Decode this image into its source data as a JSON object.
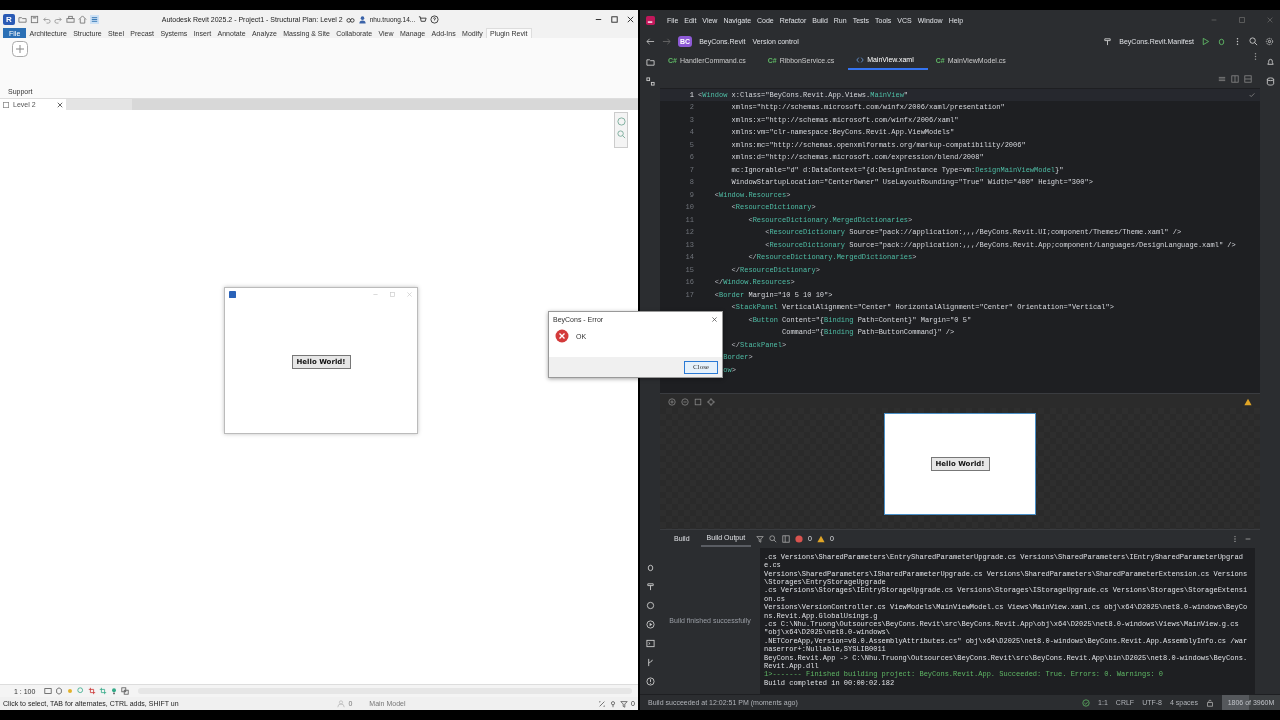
{
  "revit": {
    "app_logo": "R",
    "title": "Autodesk Revit 2025.2 - Project1 - Structural Plan: Level 2",
    "user": "nhu.truong.14...",
    "ribbon_tabs": [
      {
        "label": "File",
        "kind": "app",
        "selected": false
      },
      {
        "label": "Architecture",
        "kind": "tab",
        "selected": false
      },
      {
        "label": "Structure",
        "kind": "tab",
        "selected": false
      },
      {
        "label": "Steel",
        "kind": "tab",
        "selected": false
      },
      {
        "label": "Precast",
        "kind": "tab",
        "selected": false
      },
      {
        "label": "Systems",
        "kind": "tab",
        "selected": false
      },
      {
        "label": "Insert",
        "kind": "tab",
        "selected": false
      },
      {
        "label": "Annotate",
        "kind": "tab",
        "selected": false
      },
      {
        "label": "Analyze",
        "kind": "tab",
        "selected": false
      },
      {
        "label": "Massing & Site",
        "kind": "tab",
        "selected": false
      },
      {
        "label": "Collaborate",
        "kind": "tab",
        "selected": false
      },
      {
        "label": "View",
        "kind": "tab",
        "selected": false
      },
      {
        "label": "Manage",
        "kind": "tab",
        "selected": false
      },
      {
        "label": "Add-Ins",
        "kind": "tab",
        "selected": false
      },
      {
        "label": "Modify",
        "kind": "tab",
        "selected": false
      },
      {
        "label": "Plugin Revit",
        "kind": "tab",
        "selected": true
      }
    ],
    "panel_label": "Support",
    "view_tabs": [
      {
        "label": "Level 2",
        "selected": true
      }
    ],
    "plugin_window": {
      "button": "Hello World!"
    },
    "scale": "1 : 100",
    "status": "Click to select, TAB for alternates, CTRL adds, SHIFT un",
    "workset_count": "0",
    "model": "Main Model",
    "filter_count": "0"
  },
  "error_dialog": {
    "title": "BeyCons - Error",
    "message": "OK",
    "button": "Close"
  },
  "rider": {
    "menu": [
      "File",
      "Edit",
      "View",
      "Navigate",
      "Code",
      "Refactor",
      "Build",
      "Run",
      "Tests",
      "Tools",
      "VCS",
      "Window",
      "Help"
    ],
    "project_badge": "BC",
    "project": "BeyCons.Revit",
    "vcs": "Version control",
    "run_config": "BeyCons.Revit.Manifest",
    "tabs": [
      {
        "label": "HandlerCommand.cs",
        "badge": "C#",
        "selected": false
      },
      {
        "label": "RibbonService.cs",
        "badge": "C#",
        "selected": false
      },
      {
        "label": "MainView.xaml",
        "selected": true
      },
      {
        "label": "MainViewModel.cs",
        "badge": "C#",
        "selected": false
      }
    ],
    "code": [
      {
        "number": "1",
        "current": true,
        "tokens": [
          {
            "text": "<",
            "kind": "punct"
          },
          {
            "text": "Window",
            "kind": "tag"
          },
          {
            "text": " x:Class=\"BeyCons.Revit.App.Views.",
            "kind": "plain"
          },
          {
            "text": "MainView",
            "kind": "tag"
          },
          {
            "text": "\"",
            "kind": "plain"
          }
        ]
      },
      {
        "number": "2",
        "current": false,
        "tokens": [
          {
            "text": "        xmlns=\"http://schemas.microsoft.com/winfx/2006/xaml/presentation\"",
            "kind": "plain"
          }
        ]
      },
      {
        "number": "3",
        "current": false,
        "tokens": [
          {
            "text": "        xmlns:x=\"http://schemas.microsoft.com/winfx/2006/xaml\"",
            "kind": "plain"
          }
        ]
      },
      {
        "number": "4",
        "current": false,
        "tokens": [
          {
            "text": "        xmlns:vm=\"clr-namespace:BeyCons.Revit.App.ViewModels\"",
            "kind": "plain"
          }
        ]
      },
      {
        "number": "5",
        "current": false,
        "tokens": [
          {
            "text": "        xmlns:mc=\"http://schemas.openxmlformats.org/markup-compatibility/2006\"",
            "kind": "plain"
          }
        ]
      },
      {
        "number": "6",
        "current": false,
        "tokens": [
          {
            "text": "        xmlns:d=\"http://schemas.microsoft.com/expression/blend/2008\"",
            "kind": "plain"
          }
        ]
      },
      {
        "number": "7",
        "current": false,
        "tokens": [
          {
            "text": "        mc:Ignorable=\"d\" d:DataContext=\"{d:DesignInstance Type=vm:",
            "kind": "plain"
          },
          {
            "text": "DesignMainViewModel",
            "kind": "tag"
          },
          {
            "text": "}\"",
            "kind": "plain"
          }
        ]
      },
      {
        "number": "8",
        "current": false,
        "tokens": [
          {
            "text": "        WindowStartupLocation=\"CenterOwner\" UseLayoutRounding=\"True\" Width=\"400\" Height=\"300\">",
            "kind": "plain"
          }
        ]
      },
      {
        "number": "9",
        "current": false,
        "tokens": [
          {
            "text": "    <",
            "kind": "punct"
          },
          {
            "text": "Window.Resources",
            "kind": "tag"
          },
          {
            "text": ">",
            "kind": "punct"
          }
        ]
      },
      {
        "number": "10",
        "current": false,
        "tokens": [
          {
            "text": "        <",
            "kind": "punct"
          },
          {
            "text": "ResourceDictionary",
            "kind": "tag"
          },
          {
            "text": ">",
            "kind": "punct"
          }
        ]
      },
      {
        "number": "11",
        "current": false,
        "tokens": [
          {
            "text": "            <",
            "kind": "punct"
          },
          {
            "text": "ResourceDictionary.MergedDictionaries",
            "kind": "tag"
          },
          {
            "text": ">",
            "kind": "punct"
          }
        ]
      },
      {
        "number": "12",
        "current": false,
        "tokens": [
          {
            "text": "                <",
            "kind": "punct"
          },
          {
            "text": "ResourceDictionary",
            "kind": "tag"
          },
          {
            "text": " Source=\"pack://application:,,,/BeyCons.Revit.UI;component/Themes/Theme.xaml\" />",
            "kind": "plain"
          }
        ]
      },
      {
        "number": "13",
        "current": false,
        "tokens": [
          {
            "text": "                <",
            "kind": "punct"
          },
          {
            "text": "ResourceDictionary",
            "kind": "tag"
          },
          {
            "text": " Source=\"pack://application:,,,/BeyCons.Revit.App;component/Languages/DesignLanguage.xaml\" />",
            "kind": "plain"
          }
        ]
      },
      {
        "number": "14",
        "current": false,
        "tokens": [
          {
            "text": "            </",
            "kind": "punct"
          },
          {
            "text": "ResourceDictionary.MergedDictionaries",
            "kind": "tag"
          },
          {
            "text": ">",
            "kind": "punct"
          }
        ]
      },
      {
        "number": "15",
        "current": false,
        "tokens": [
          {
            "text": "        </",
            "kind": "punct"
          },
          {
            "text": "ResourceDictionary",
            "kind": "tag"
          },
          {
            "text": ">",
            "kind": "punct"
          }
        ]
      },
      {
        "number": "16",
        "current": false,
        "tokens": [
          {
            "text": "    </",
            "kind": "punct"
          },
          {
            "text": "Window.Resources",
            "kind": "tag"
          },
          {
            "text": ">",
            "kind": "punct"
          }
        ]
      },
      {
        "number": "17",
        "current": false,
        "tokens": [
          {
            "text": "    <",
            "kind": "punct"
          },
          {
            "text": "Border",
            "kind": "tag"
          },
          {
            "text": " Margin=\"10 5 10 10\">",
            "kind": "plain"
          }
        ]
      },
      {
        "current": false,
        "tokens": [
          {
            "text": "        <",
            "kind": "punct"
          },
          {
            "text": "StackPanel",
            "kind": "tag"
          },
          {
            "text": " VerticalAlignment=\"Center\" HorizontalAlignment=\"Center\" Orientation=\"Vertical\">",
            "kind": "plain"
          }
        ]
      },
      {
        "current": false,
        "tokens": [
          {
            "text": "            <",
            "kind": "punct"
          },
          {
            "text": "Button",
            "kind": "tag"
          },
          {
            "text": " Content=\"{",
            "kind": "plain"
          },
          {
            "text": "Binding",
            "kind": "tag"
          },
          {
            "text": " Path=Content}\" Margin=\"0 5\"",
            "kind": "plain"
          }
        ]
      },
      {
        "current": false,
        "tokens": [
          {
            "text": "                    Command=\"{",
            "kind": "plain"
          },
          {
            "text": "Binding",
            "kind": "tag"
          },
          {
            "text": " Path=ButtonCommand}\" />",
            "kind": "plain"
          }
        ]
      },
      {
        "current": false,
        "tokens": [
          {
            "text": "        </",
            "kind": "punct"
          },
          {
            "text": "StackPanel",
            "kind": "tag"
          },
          {
            "text": ">",
            "kind": "punct"
          }
        ]
      },
      {
        "current": false,
        "tokens": [
          {
            "text": "      Border",
            "kind": "tag"
          },
          {
            "text": ">",
            "kind": "punct"
          }
        ]
      },
      {
        "current": false,
        "tokens": [
          {
            "text": "      ow",
            "kind": "tag"
          },
          {
            "text": ">",
            "kind": "punct"
          }
        ]
      }
    ],
    "preview": {
      "button": "Hello World!"
    },
    "build": {
      "tabs": [
        {
          "label": "Build",
          "selected": false
        },
        {
          "label": "Build Output",
          "selected": true
        }
      ],
      "errors": "0",
      "warnings": "0",
      "summary": "Build finished successfully",
      "output": [
        {
          "text": ".cs Versions\\SharedParameters\\EntrySharedParameterUpgrade.cs Versions\\SharedParameters\\IEntrySharedParameterUpgrade.cs",
          "kind": "normal"
        },
        {
          "text": "Versions\\SharedParameters\\ISharedParameterUpgrade.cs Versions\\SharedParameters\\SharedParameterExtension.cs Versions\\Storages\\EntryStorageUpgrade",
          "kind": "normal"
        },
        {
          "text": ".cs Versions\\Storages\\IEntryStorageUpgrade.cs Versions\\Storages\\IStorageUpgrade.cs Versions\\Storages\\StorageExtension.cs",
          "kind": "normal"
        },
        {
          "text": "Versions\\VersionController.cs ViewModels\\MainViewModel.cs Views\\MainView.xaml.cs obj\\x64\\D2025\\net8.0-windows\\BeyCons.Revit.App.GlobalUsings.g",
          "kind": "normal"
        },
        {
          "text": ".cs C:\\Nhu.Truong\\Outsources\\BeyCons.Revit\\src\\BeyCons.Revit.App\\obj\\x64\\D2025\\net8.0-windows\\Views\\MainView.g.cs \"obj\\x64\\D2025\\net8.0-windows\\",
          "kind": "normal"
        },
        {
          "text": ".NETCoreApp,Version=v8.0.AssemblyAttributes.cs\" obj\\x64\\D2025\\net8.0-windows\\BeyCons.Revit.App.AssemblyInfo.cs /warnaserror+:Nullable,SYSLIB0011",
          "kind": "normal"
        },
        {
          "text": "BeyCons.Revit.App -> C:\\Nhu.Truong\\Outsources\\BeyCons.Revit\\src\\BeyCons.Revit.App\\bin\\D2025\\net8.0-windows\\BeyCons.Revit.App.dll",
          "kind": "normal"
        },
        {
          "text": "1>------- Finished building project: BeyCons.Revit.App. Succeeded: True. Errors: 0. Warnings: 0",
          "kind": "success"
        },
        {
          "text": "Build completed in 00:00:02.182",
          "kind": "normal"
        }
      ]
    },
    "status": {
      "message": "Build succeeded at 12:02:51 PM (moments ago)",
      "position": "1:1",
      "line_ending": "CRLF",
      "encoding": "UTF-8",
      "indent": "4 spaces",
      "memory": {
        "text": "1806 of 3960M",
        "level": 0.46
      }
    }
  }
}
